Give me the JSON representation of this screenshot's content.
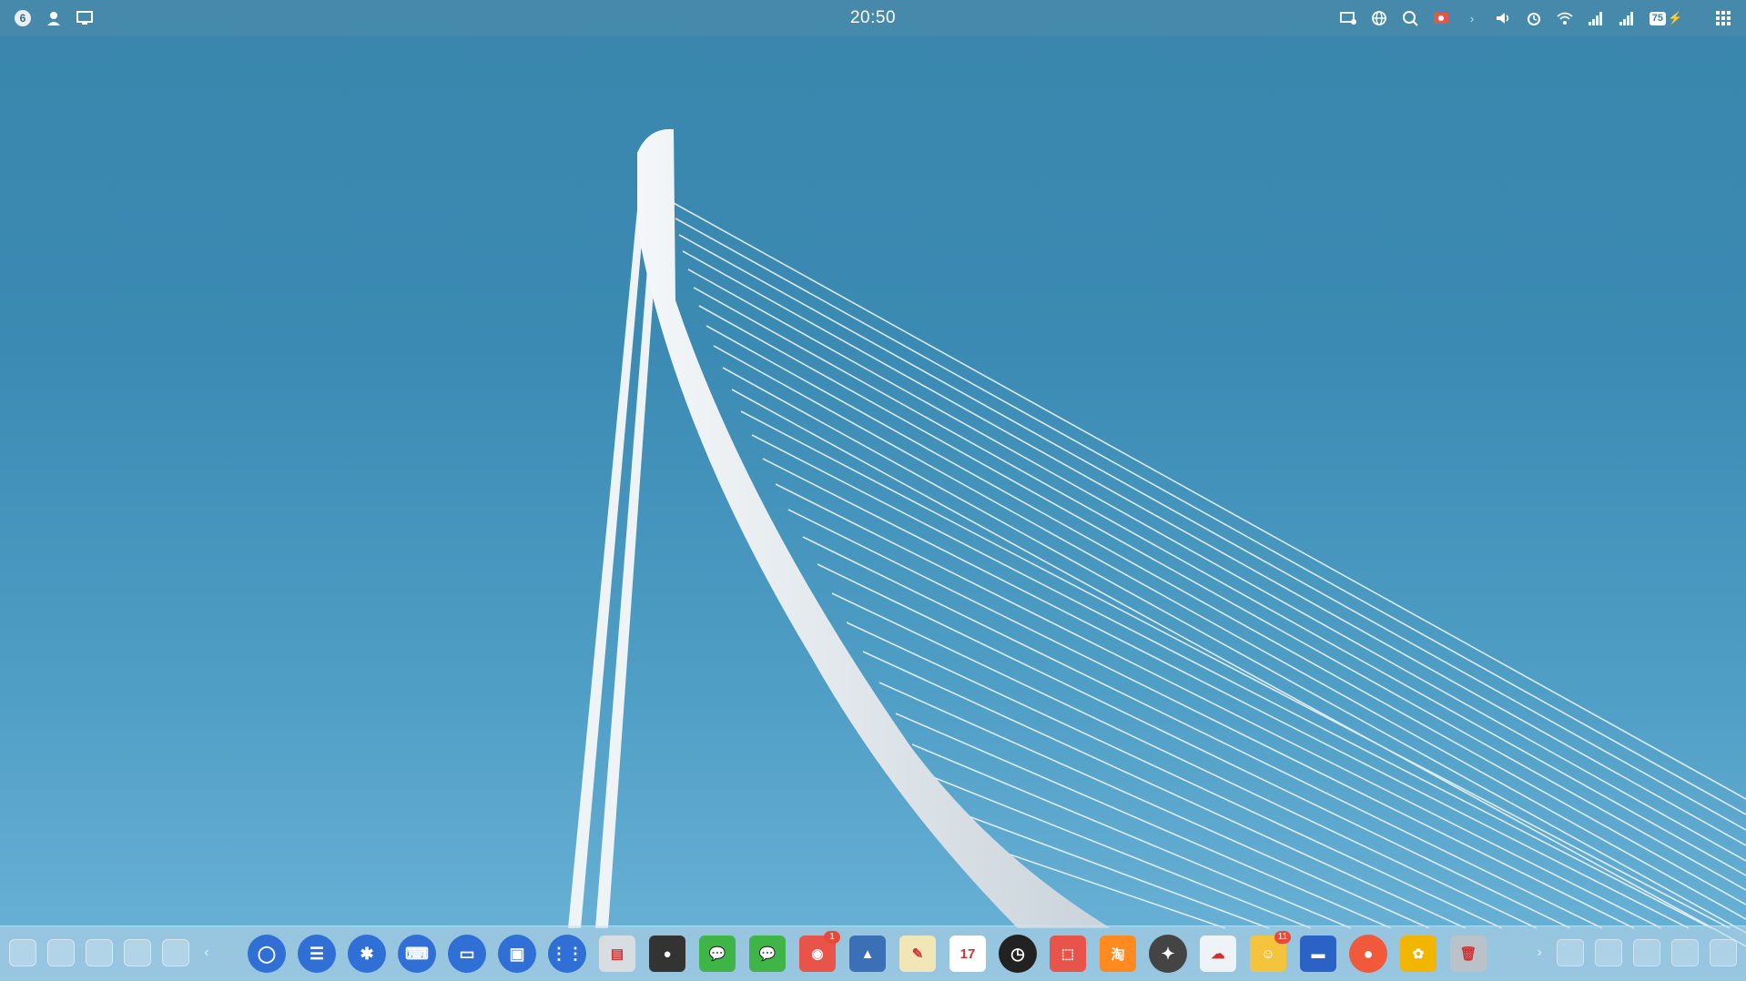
{
  "topbar": {
    "workspace_badge": "6",
    "clock": "20:50",
    "battery_level": "75",
    "left_icons": [
      "workspace-badge-icon",
      "user-icon",
      "screen-share-icon"
    ],
    "right_icons": [
      "display-icon",
      "globe-icon",
      "search-icon",
      "screen-record-icon",
      "chevron-right-icon",
      "volume-icon",
      "alarm-icon",
      "wifi-icon",
      "signal-icon",
      "signal-2-icon",
      "battery-icon",
      "app-grid-icon"
    ]
  },
  "dock": {
    "left_system_icons": [
      "settings-icon",
      "copy-icon",
      "window-icon",
      "toggle-icon",
      "refresh-icon"
    ],
    "apps": [
      {
        "name": "browser-app",
        "glyph": "◯",
        "color": "#2f6fd6"
      },
      {
        "name": "list-app",
        "glyph": "☰",
        "color": "#2f6fd6"
      },
      {
        "name": "settings-app",
        "glyph": "✱",
        "color": "#2f6fd6"
      },
      {
        "name": "keyboard-app",
        "glyph": "⌨",
        "color": "#2f6fd6"
      },
      {
        "name": "monitor-app",
        "glyph": "▭",
        "color": "#2f6fd6"
      },
      {
        "name": "window-app",
        "glyph": "▣",
        "color": "#2f6fd6"
      },
      {
        "name": "launcher-app",
        "glyph": "⋮⋮",
        "color": "#2f6fd6"
      },
      {
        "name": "file-manager-app",
        "glyph": "▤",
        "color": "#d8dde2"
      },
      {
        "name": "music-app",
        "glyph": "●",
        "color": "#333333"
      },
      {
        "name": "wechat-app",
        "glyph": "💬",
        "color": "#3fb447"
      },
      {
        "name": "wechat-2-app",
        "glyph": "💬",
        "color": "#3fb447"
      },
      {
        "name": "weibo-app",
        "glyph": "◉",
        "color": "#e8544a",
        "badge": "1"
      },
      {
        "name": "photo-app",
        "glyph": "▲",
        "color": "#3b6fb6"
      },
      {
        "name": "notes-app",
        "glyph": "✎",
        "color": "#f1e6b5"
      },
      {
        "name": "calendar-app",
        "glyph": "17",
        "color": "#ffffff"
      },
      {
        "name": "clock-app",
        "glyph": "◷",
        "color": "#222222"
      },
      {
        "name": "store-app",
        "glyph": "⬚",
        "color": "#e8544a"
      },
      {
        "name": "taobao-app",
        "glyph": "淘",
        "color": "#ff8a1f"
      },
      {
        "name": "compass-app",
        "glyph": "✦",
        "color": "#444444"
      },
      {
        "name": "cloud-app",
        "glyph": "☁",
        "color": "#eef3f7"
      },
      {
        "name": "smiley-app",
        "glyph": "☺",
        "color": "#f3c43c",
        "badge": "11"
      },
      {
        "name": "flag-app",
        "glyph": "▬",
        "color": "#2a62c6"
      },
      {
        "name": "mascot-app",
        "glyph": "●",
        "color": "#f05a3a"
      },
      {
        "name": "sunflower-app",
        "glyph": "✿",
        "color": "#f2b500"
      },
      {
        "name": "trash-app",
        "glyph": "🗑",
        "color": "#b9c2c9"
      }
    ],
    "right_tray_icons": [
      "image-icon",
      "folder-icon",
      "doc-icon",
      "list-icon",
      "desktop-icon"
    ]
  }
}
